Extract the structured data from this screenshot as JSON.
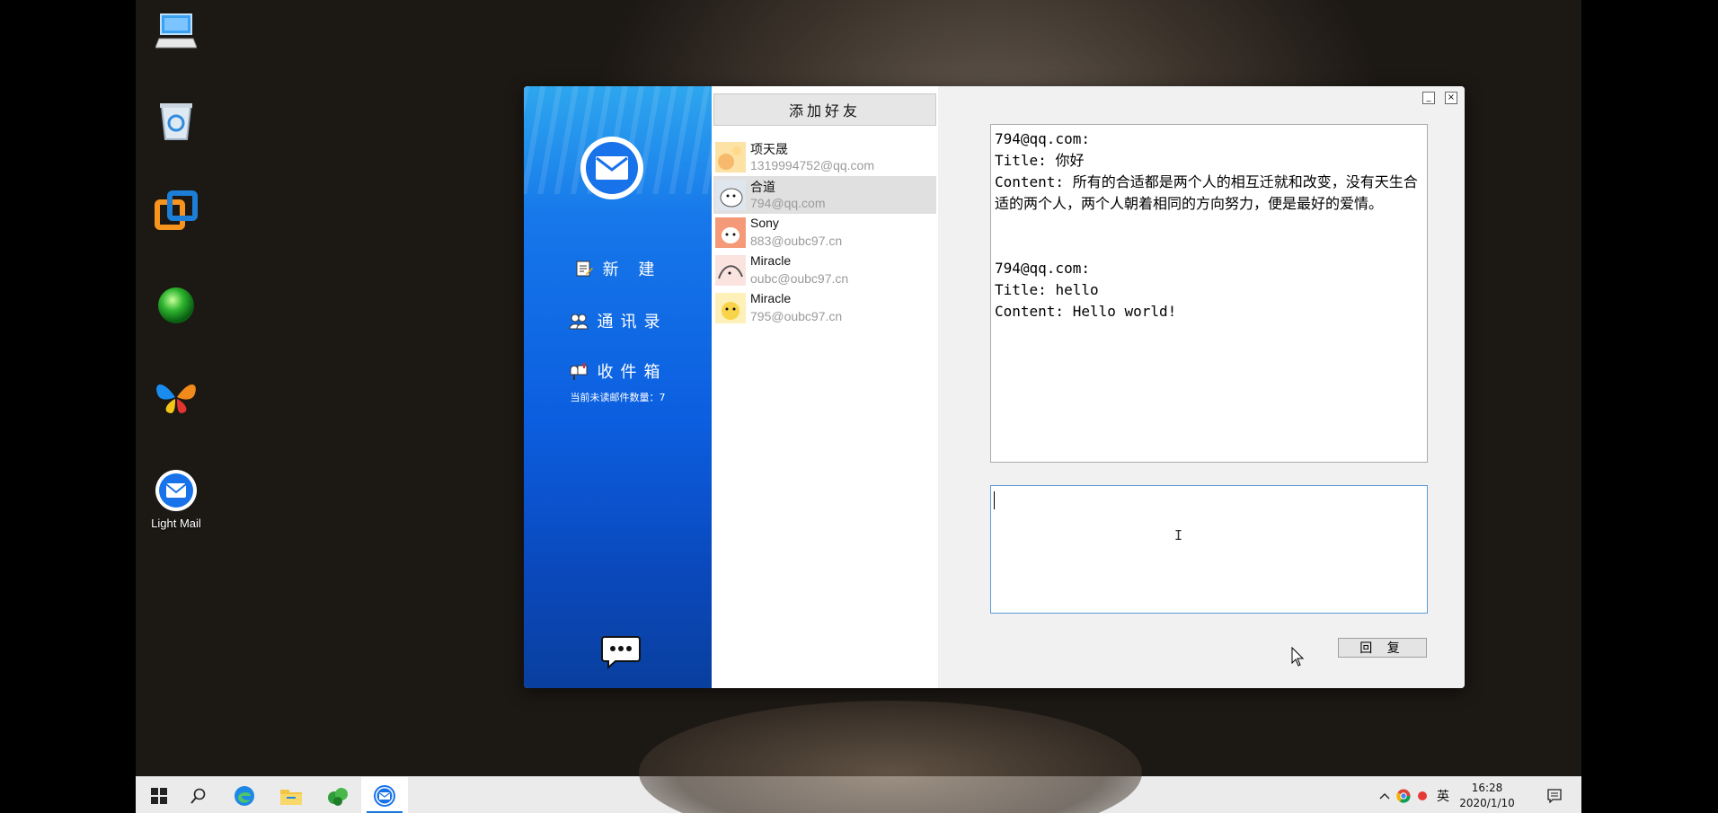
{
  "desktop": {
    "icons": [
      {
        "name": "this-pc",
        "label": ""
      },
      {
        "name": "recycle-bin",
        "label": ""
      },
      {
        "name": "vmware",
        "label": ""
      },
      {
        "name": "green-ball",
        "label": ""
      },
      {
        "name": "butterfly",
        "label": ""
      },
      {
        "name": "light-mail",
        "label": "Light Mail"
      }
    ]
  },
  "sidebar": {
    "new_label": "新 建",
    "contacts_label": "通讯录",
    "inbox_label": "收件箱",
    "unread_text": "当前未读邮件数量：7",
    "colors": {
      "top": "#2ea6ee",
      "bottom": "#093f9e"
    }
  },
  "contacts": {
    "add_friend_label": "添加好友",
    "items": [
      {
        "name": "项天晟",
        "email": "1319994752@qq.com",
        "selected": false
      },
      {
        "name": "合道",
        "email": "794@qq.com",
        "selected": true
      },
      {
        "name": "Sony",
        "email": "883@oubc97.cn",
        "selected": false
      },
      {
        "name": "Miracle",
        "email": "oubc@oubc97.cn",
        "selected": false
      },
      {
        "name": "Miracle",
        "email": "795@oubc97.cn",
        "selected": false
      }
    ]
  },
  "window": {
    "minimize_label": "_",
    "close_label": "×"
  },
  "messages": [
    {
      "from": "794@qq.com:",
      "title_prefix": "Title: ",
      "title": "你好",
      "content_prefix": "Content: ",
      "content": "所有的合适都是两个人的相互迁就和改变，没有天生合适的两个人，两个人朝着相同的方向努力，便是最好的爱情。"
    },
    {
      "from": "794@qq.com:",
      "title_prefix": "Title: ",
      "title": "hello",
      "content_prefix": "Content: ",
      "content": "Hello world!"
    }
  ],
  "reply": {
    "input_value": "",
    "button_label": "回 复"
  },
  "taskbar": {
    "ime": "英",
    "time": "16:28",
    "date": "2020/1/10"
  }
}
